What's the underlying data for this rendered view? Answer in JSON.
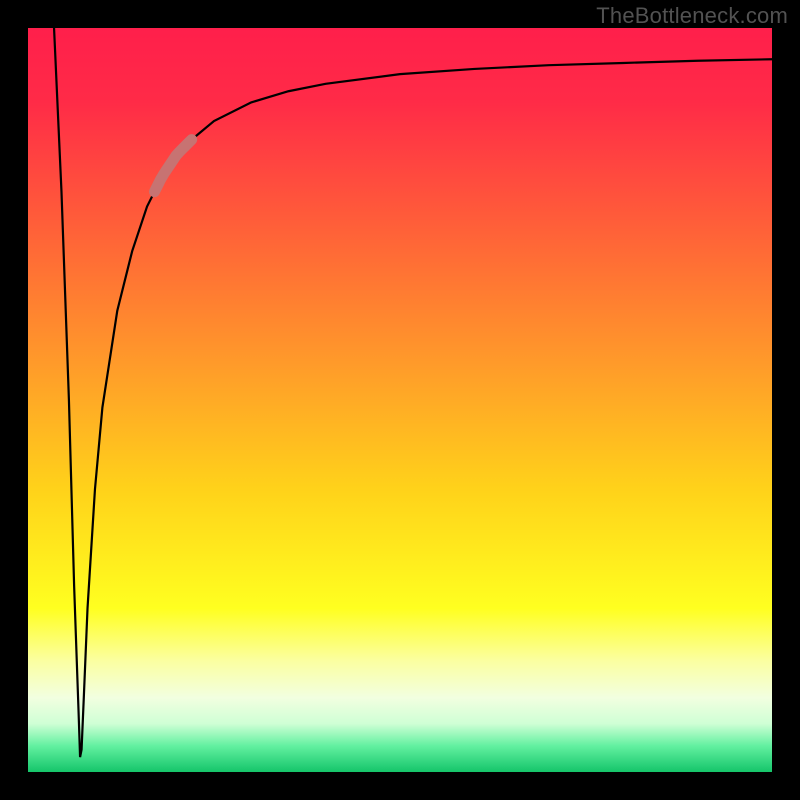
{
  "watermark": "TheBottleneck.com",
  "colors": {
    "frame": "#000000",
    "curve": "#000000",
    "marker": "#c77372",
    "watermark_text": "#525252",
    "gradient_stops": [
      {
        "offset": 0.0,
        "color": "#ff1f4b"
      },
      {
        "offset": 0.1,
        "color": "#ff2b47"
      },
      {
        "offset": 0.25,
        "color": "#ff5a3a"
      },
      {
        "offset": 0.45,
        "color": "#ff9a2a"
      },
      {
        "offset": 0.62,
        "color": "#ffd21a"
      },
      {
        "offset": 0.78,
        "color": "#ffff20"
      },
      {
        "offset": 0.85,
        "color": "#fbffa0"
      },
      {
        "offset": 0.9,
        "color": "#f2ffe0"
      },
      {
        "offset": 0.935,
        "color": "#cfffd5"
      },
      {
        "offset": 0.965,
        "color": "#62f0a0"
      },
      {
        "offset": 1.0,
        "color": "#15c56a"
      }
    ]
  },
  "chart_data": {
    "type": "line",
    "title": "",
    "xlabel": "",
    "ylabel": "",
    "xlim": [
      0,
      100
    ],
    "ylim": [
      0,
      100
    ],
    "series": [
      {
        "name": "curve",
        "x": [
          3.5,
          4.5,
          5.5,
          6.2,
          6.8,
          7.0,
          7.2,
          7.5,
          8.0,
          9.0,
          10.0,
          12.0,
          14.0,
          16.0,
          18.0,
          20.0,
          22.0,
          25.0,
          30.0,
          35.0,
          40.0,
          50.0,
          60.0,
          70.0,
          80.0,
          90.0,
          100.0
        ],
        "y": [
          100.0,
          78.0,
          50.0,
          25.0,
          8.0,
          2.0,
          3.0,
          10.0,
          22.0,
          38.0,
          49.0,
          62.0,
          70.0,
          76.0,
          80.0,
          83.0,
          85.0,
          87.5,
          90.0,
          91.5,
          92.5,
          93.8,
          94.5,
          95.0,
          95.3,
          95.6,
          95.8
        ]
      }
    ],
    "marker": {
      "name": "highlight-segment",
      "x_range": [
        17.0,
        22.0
      ],
      "y_range": [
        77.5,
        85.0
      ]
    }
  }
}
